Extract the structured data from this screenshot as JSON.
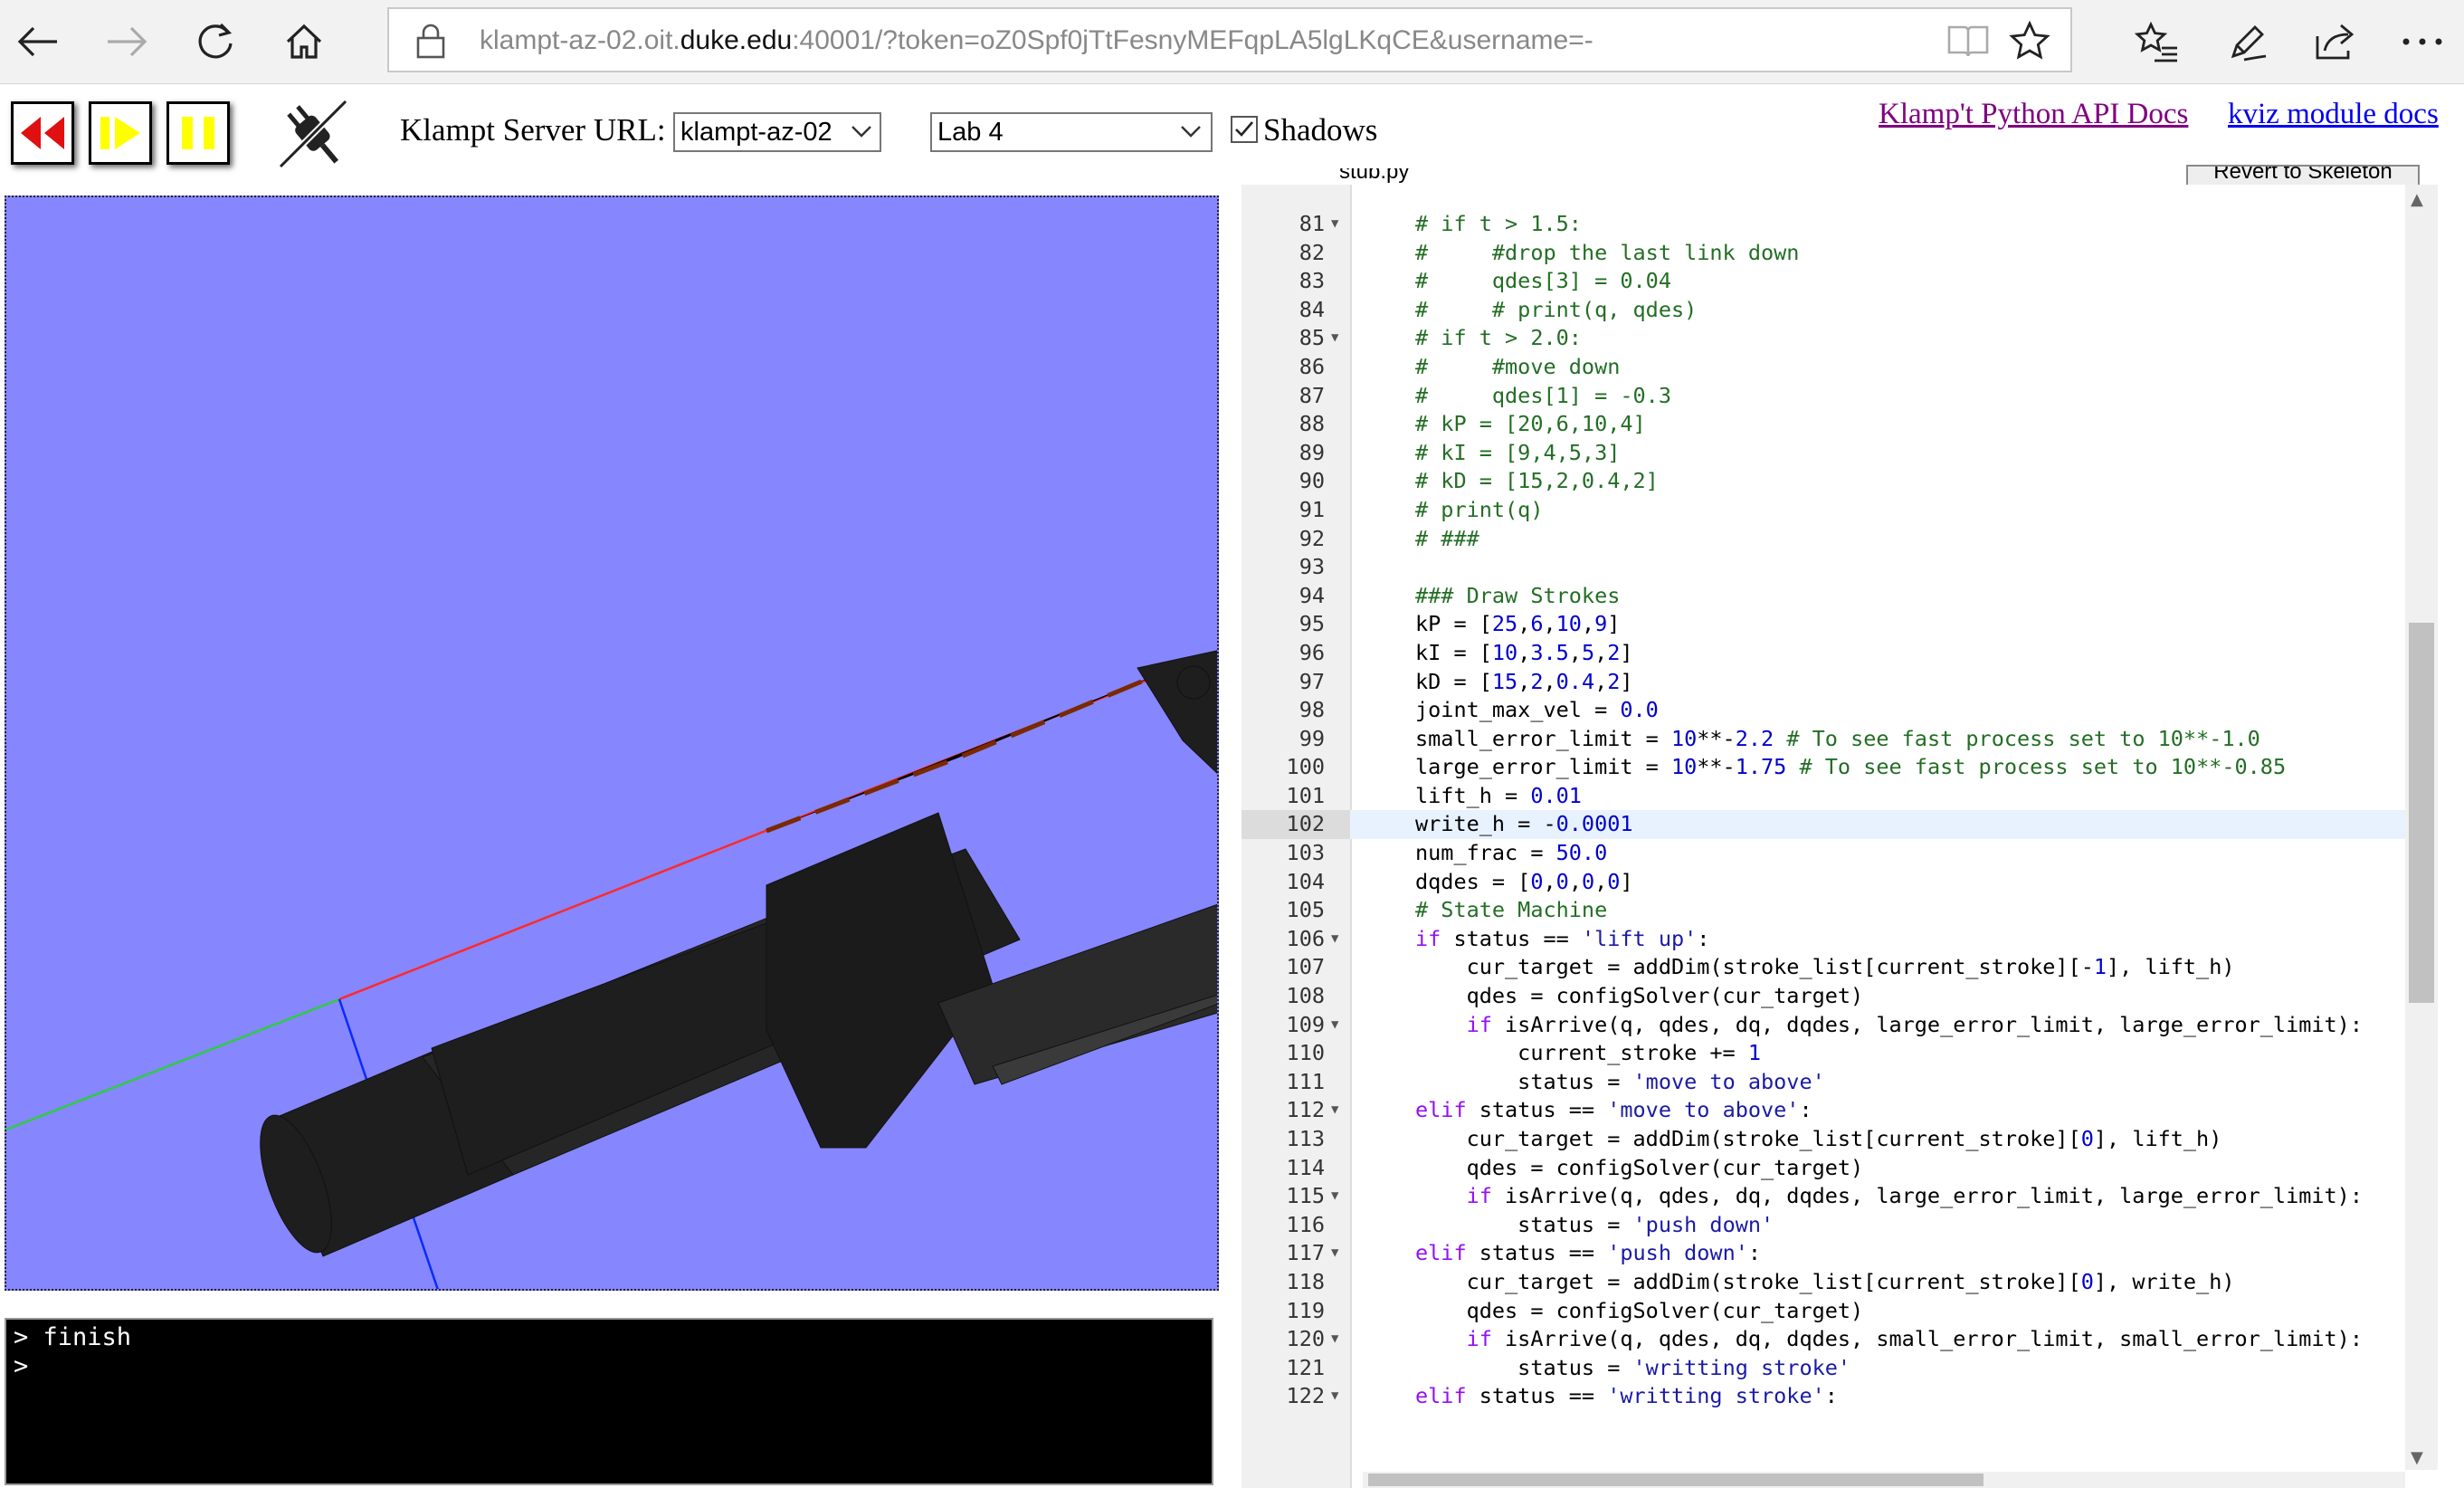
{
  "browser": {
    "url_prefix": "klampt-az-02.oit.",
    "url_host": "duke.edu",
    "url_suffix": ":40001/?token=oZ0Spf0jTtFesnyMEFqpLA5lgLKqCE&username=-"
  },
  "toolbar": {
    "server_label": "Klampt Server URL:",
    "server_value": "klampt-az-02",
    "lab_value": "Lab 4",
    "shadows_label": "Shadows",
    "shadows_checked": true,
    "api_docs_link": "Klamp't Python API Docs",
    "kviz_docs_link": "kviz module docs"
  },
  "editor": {
    "tab_label": "stub.py",
    "revert_button": "Revert to Skeleton",
    "active_line": 102,
    "lines": [
      {
        "n": 81,
        "fold": true,
        "t": "# if t > 1.5:"
      },
      {
        "n": 82,
        "fold": false,
        "t": "#     #drop the last link down"
      },
      {
        "n": 83,
        "fold": false,
        "t": "#     qdes[3] = 0.04"
      },
      {
        "n": 84,
        "fold": false,
        "t": "#     # print(q, qdes)"
      },
      {
        "n": 85,
        "fold": true,
        "t": "# if t > 2.0:"
      },
      {
        "n": 86,
        "fold": false,
        "t": "#     #move down"
      },
      {
        "n": 87,
        "fold": false,
        "t": "#     qdes[1] = -0.3"
      },
      {
        "n": 88,
        "fold": false,
        "t": "# kP = [20,6,10,4]"
      },
      {
        "n": 89,
        "fold": false,
        "t": "# kI = [9,4,5,3]"
      },
      {
        "n": 90,
        "fold": false,
        "t": "# kD = [15,2,0.4,2]"
      },
      {
        "n": 91,
        "fold": false,
        "t": "# print(q)"
      },
      {
        "n": 92,
        "fold": false,
        "t": "# ###"
      },
      {
        "n": 93,
        "fold": false,
        "t": ""
      },
      {
        "n": 94,
        "fold": false,
        "t": "### Draw Strokes"
      },
      {
        "n": 95,
        "fold": false,
        "t": "kP = [25,6,10,9]"
      },
      {
        "n": 96,
        "fold": false,
        "t": "kI = [10,3.5,5,2]"
      },
      {
        "n": 97,
        "fold": false,
        "t": "kD = [15,2,0.4,2]"
      },
      {
        "n": 98,
        "fold": false,
        "t": "joint_max_vel = 0.0"
      },
      {
        "n": 99,
        "fold": false,
        "t": "small_error_limit = 10**-2.2 # To see fast process set to 10**-1.0"
      },
      {
        "n": 100,
        "fold": false,
        "t": "large_error_limit = 10**-1.75 # To see fast process set to 10**-0.85"
      },
      {
        "n": 101,
        "fold": false,
        "t": "lift_h = 0.01"
      },
      {
        "n": 102,
        "fold": false,
        "t": "write_h = -0.0001"
      },
      {
        "n": 103,
        "fold": false,
        "t": "num_frac = 50.0"
      },
      {
        "n": 104,
        "fold": false,
        "t": "dqdes = [0,0,0,0]"
      },
      {
        "n": 105,
        "fold": false,
        "t": "# State Machine"
      },
      {
        "n": 106,
        "fold": true,
        "t": "if status == 'lift up':"
      },
      {
        "n": 107,
        "fold": false,
        "t": "    cur_target = addDim(stroke_list[current_stroke][-1], lift_h)"
      },
      {
        "n": 108,
        "fold": false,
        "t": "    qdes = configSolver(cur_target)"
      },
      {
        "n": 109,
        "fold": true,
        "t": "    if isArrive(q, qdes, dq, dqdes, large_error_limit, large_error_limit):"
      },
      {
        "n": 110,
        "fold": false,
        "t": "        current_stroke += 1"
      },
      {
        "n": 111,
        "fold": false,
        "t": "        status = 'move to above'"
      },
      {
        "n": 112,
        "fold": true,
        "t": "elif status == 'move to above':"
      },
      {
        "n": 113,
        "fold": false,
        "t": "    cur_target = addDim(stroke_list[current_stroke][0], lift_h)"
      },
      {
        "n": 114,
        "fold": false,
        "t": "    qdes = configSolver(cur_target)"
      },
      {
        "n": 115,
        "fold": true,
        "t": "    if isArrive(q, qdes, dq, dqdes, large_error_limit, large_error_limit):"
      },
      {
        "n": 116,
        "fold": false,
        "t": "        status = 'push down'"
      },
      {
        "n": 117,
        "fold": true,
        "t": "elif status == 'push down':"
      },
      {
        "n": 118,
        "fold": false,
        "t": "    cur_target = addDim(stroke_list[current_stroke][0], write_h)"
      },
      {
        "n": 119,
        "fold": false,
        "t": "    qdes = configSolver(cur_target)"
      },
      {
        "n": 120,
        "fold": true,
        "t": "    if isArrive(q, qdes, dq, dqdes, small_error_limit, small_error_limit):"
      },
      {
        "n": 121,
        "fold": false,
        "t": "        status = 'writting stroke'"
      },
      {
        "n": 122,
        "fold": true,
        "t": "elif status == 'writting stroke':"
      }
    ]
  },
  "console": {
    "lines": [
      "> finish",
      ">"
    ]
  },
  "colors": {
    "viewport_bg": "#8686fe",
    "robot": "#1e1e1e",
    "link_visited": "#800080",
    "link": "#0000ee"
  }
}
